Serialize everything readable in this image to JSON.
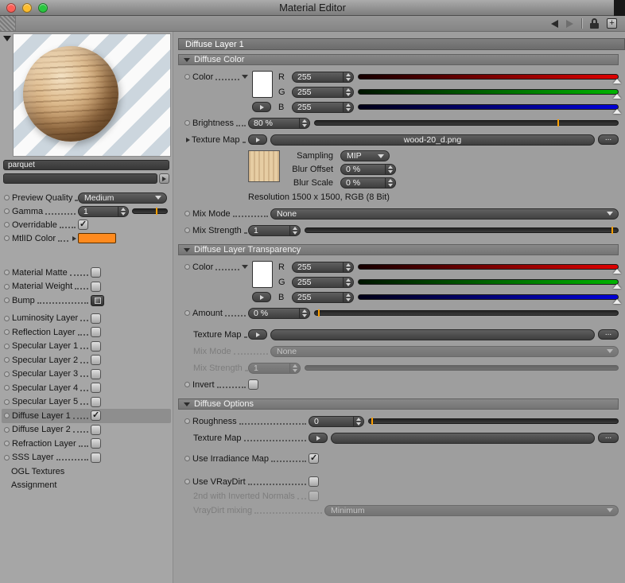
{
  "window": {
    "title": "Material Editor"
  },
  "toolbar": {
    "add_button": "+"
  },
  "colors": {
    "accent_orange": "#ffa000",
    "mtlid_swatch": "#ff8a1e"
  },
  "sidebar": {
    "material_name": "parquet",
    "preview_quality": {
      "label": "Preview Quality",
      "value": "Medium"
    },
    "gamma": {
      "label": "Gamma",
      "value": "1"
    },
    "overridable": {
      "label": "Overridable",
      "checked": true
    },
    "mtlid_color": {
      "label": "MtlID Color",
      "color": "#ff8a1e"
    },
    "channels": [
      {
        "label": "Material Matte",
        "control": "checkbox",
        "checked": false
      },
      {
        "label": "Material Weight",
        "control": "checkbox",
        "checked": false
      },
      {
        "label": "Bump",
        "control": "button"
      },
      {
        "label": "Luminosity Layer",
        "control": "checkbox",
        "checked": false
      },
      {
        "label": "Reflection Layer",
        "control": "checkbox",
        "checked": false
      },
      {
        "label": "Specular Layer 1",
        "control": "checkbox",
        "checked": false
      },
      {
        "label": "Specular Layer 2",
        "control": "checkbox",
        "checked": false
      },
      {
        "label": "Specular Layer 3",
        "control": "checkbox",
        "checked": false
      },
      {
        "label": "Specular Layer 4",
        "control": "checkbox",
        "checked": false
      },
      {
        "label": "Specular Layer 5",
        "control": "checkbox",
        "checked": false
      },
      {
        "label": "Diffuse Layer 1",
        "control": "checkbox",
        "checked": true,
        "selected": true
      },
      {
        "label": "Diffuse Layer 2",
        "control": "checkbox",
        "checked": false
      },
      {
        "label": "Refraction Layer",
        "control": "checkbox",
        "checked": false
      },
      {
        "label": "SSS Layer",
        "control": "checkbox",
        "checked": false
      }
    ],
    "extra_items": [
      "OGL Textures",
      "Assignment"
    ]
  },
  "main": {
    "header": "Diffuse Layer 1",
    "diffuse_color": {
      "title": "Diffuse Color",
      "color_label": "Color",
      "channel_r": "R",
      "channel_g": "G",
      "channel_b": "B",
      "r": "255",
      "g": "255",
      "b": "255",
      "brightness_label": "Brightness",
      "brightness": "80 %",
      "texture_map_label": "Texture Map",
      "texture_file": "wood-20_d.png",
      "browse_label": "...",
      "sampling_label": "Sampling",
      "sampling": "MIP",
      "blur_offset_label": "Blur Offset",
      "blur_offset": "0 %",
      "blur_scale_label": "Blur Scale",
      "blur_scale": "0 %",
      "resolution": "Resolution 1500 x 1500, RGB (8 Bit)",
      "mix_mode_label": "Mix Mode",
      "mix_mode": "None",
      "mix_strength_label": "Mix Strength",
      "mix_strength": "1"
    },
    "transparency": {
      "title": "Diffuse Layer Transparency",
      "color_label": "Color",
      "channel_r": "R",
      "channel_g": "G",
      "channel_b": "B",
      "r": "255",
      "g": "255",
      "b": "255",
      "amount_label": "Amount",
      "amount": "0 %",
      "texture_map_label": "Texture Map",
      "browse_label": "...",
      "mix_mode_label": "Mix Mode",
      "mix_mode": "None",
      "mix_strength_label": "Mix Strength",
      "mix_strength": "1",
      "invert_label": "Invert",
      "invert_checked": false
    },
    "options": {
      "title": "Diffuse Options",
      "roughness_label": "Roughness",
      "roughness": "0",
      "texture_map_label": "Texture Map",
      "browse_label": "...",
      "use_irradiance_label": "Use Irradiance Map",
      "use_irradiance_checked": true,
      "use_vraydirt_label": "Use VRayDirt",
      "use_vraydirt_checked": false,
      "inverted_normals_label": "2nd with Inverted Normals",
      "inverted_normals_checked": false,
      "vraydirt_mixing_label": "VrayDirt mixing",
      "vraydirt_mixing": "Minimum"
    }
  }
}
